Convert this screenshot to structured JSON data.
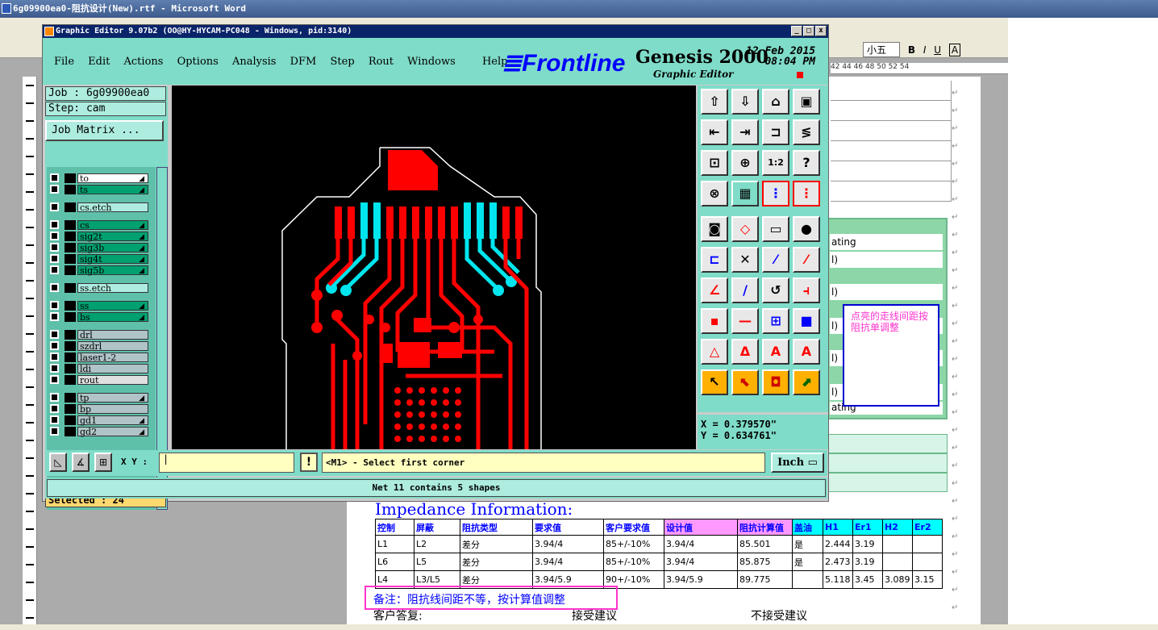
{
  "word": {
    "title": "6g09900ea0-阻抗设计(New).rtf - Microsoft Word",
    "fontsize": "小五",
    "format_buttons": [
      "B",
      "I",
      "U",
      "A"
    ],
    "ruler_text": "42  44  46  48  50  52  54",
    "green_lines": [
      "ating",
      "l)",
      "l)",
      "l)",
      "l)",
      "l)",
      "ating"
    ],
    "note_box": "点亮的走线间距按阻抗单调整",
    "impedance_title": "Impedance Information:",
    "table": {
      "headers": [
        "控制",
        "屏蔽",
        "阻抗类型",
        "要求值",
        "客户要求值",
        "设计值",
        "阻抗计算值",
        "盖油",
        "H1",
        "Er1",
        "H2",
        "Er2"
      ],
      "rows": [
        [
          "L1",
          "L2",
          "差分",
          "3.94/4",
          "85+/-10%",
          "3.94/4",
          "85.501",
          "是",
          "2.444",
          "3.19",
          "",
          ""
        ],
        [
          "L6",
          "L5",
          "差分",
          "3.94/4",
          "85+/-10%",
          "3.94/4",
          "85.875",
          "是",
          "2.473",
          "3.19",
          "",
          ""
        ],
        [
          "L4",
          "L3/L5",
          "差分",
          "3.94/5.9",
          "90+/-10%",
          "3.94/5.9",
          "89.775",
          "",
          "5.118",
          "3.45",
          "3.089",
          "3.15"
        ]
      ]
    },
    "remark": "备注：阻抗线间距不等，按计算值调整",
    "reply_label": "客户答复:",
    "accept": "接受建议",
    "reject": "不接受建议"
  },
  "editor": {
    "title": "Graphic Editor 9.07b2 (OO@HY-HYCAM-PC048 - Windows, pid:3140)",
    "win_buttons": [
      "_",
      "□",
      "x"
    ],
    "menu": [
      "File",
      "Edit",
      "Actions",
      "Options",
      "Analysis",
      "DFM",
      "Step",
      "Rout",
      "Windows",
      "Help"
    ],
    "brand": "Frontline",
    "product": "Genesis 2000",
    "subtitle": "Graphic Editor",
    "date_line1": "12 Feb 2015",
    "date_line2": "08:04 PM",
    "job": "Job : 6g09900ea0",
    "step": "Step: cam",
    "job_matrix": "Job Matrix ...",
    "layers": [
      {
        "name": "to",
        "color": "#ffffff",
        "arrow": true
      },
      {
        "name": "ts",
        "color": "#00a070",
        "arrow": true
      },
      {
        "name": "cs.etch",
        "color": "#aeece0",
        "arrow": false
      },
      {
        "name": "cs",
        "color": "#00a070",
        "arrow": true
      },
      {
        "name": "sig2t",
        "color": "#00a070",
        "arrow": true
      },
      {
        "name": "sig3b",
        "color": "#00a070",
        "arrow": true
      },
      {
        "name": "sig4t",
        "color": "#00a070",
        "arrow": true
      },
      {
        "name": "sig5b",
        "color": "#00a070",
        "arrow": true
      },
      {
        "name": "ss.etch",
        "color": "#aeece0",
        "arrow": false
      },
      {
        "name": "ss",
        "color": "#00a070",
        "arrow": true
      },
      {
        "name": "bs",
        "color": "#00a070",
        "arrow": true
      },
      {
        "name": "drl",
        "color": "#b0c4c8",
        "arrow": false
      },
      {
        "name": "szdrl",
        "color": "#b0c4c8",
        "arrow": false
      },
      {
        "name": "laser1-2",
        "color": "#b0c4c8",
        "arrow": false
      },
      {
        "name": "ldi",
        "color": "#b0c4c8",
        "arrow": false
      },
      {
        "name": "rout",
        "color": "#e0e0e0",
        "arrow": false
      },
      {
        "name": "tp",
        "color": "#b0c4c8",
        "arrow": true
      },
      {
        "name": "bp",
        "color": "#b0c4c8",
        "arrow": false
      },
      {
        "name": "gd1",
        "color": "#b0c4c8",
        "arrow": true
      },
      {
        "name": "gd2",
        "color": "#b0c4c8",
        "arrow": true
      }
    ],
    "selected": "Selected : 24",
    "coord_x": "X = 0.379570\"",
    "coord_y": "Y = 0.634761\"",
    "xy_label": "X Y :",
    "prompt": "<M1> - Select first corner",
    "unit": "Inch",
    "status": "Net 11 contains 5 shapes",
    "colors": {
      "accent": "#7fdcc8",
      "trace_red": "#ff0000",
      "trace_cyan": "#00e5ee",
      "tool_yellow": "#ffb000"
    }
  }
}
